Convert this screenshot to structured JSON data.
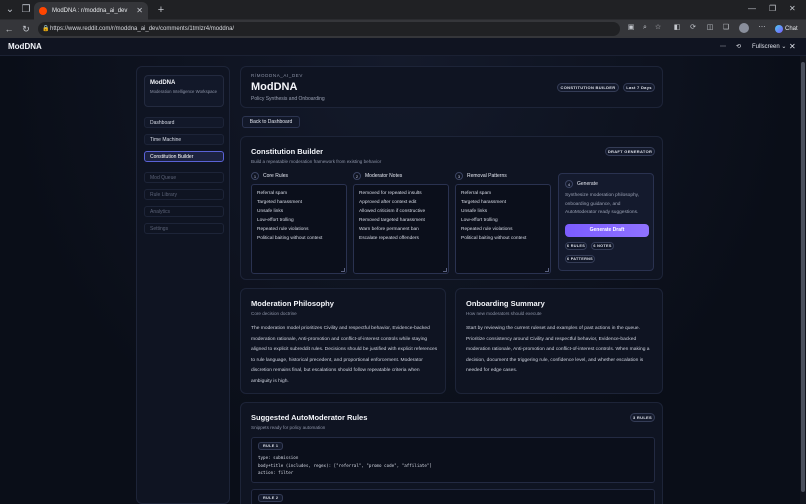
{
  "browser": {
    "tab_title": "ModDNA : r/moddna_ai_dev",
    "url": "https://www.reddit.com/r/moddna_ai_dev/comments/1tmlzr4/moddna/",
    "chat_label": "Chat"
  },
  "app_header": {
    "title": "ModDNA",
    "fullscreen_label": "Fullscreen"
  },
  "sidebar": {
    "brand_name": "ModDNA",
    "brand_sub": "Moderation Intelligence Workspace",
    "items": [
      {
        "label": "Dashboard"
      },
      {
        "label": "Time Machine"
      },
      {
        "label": "Constitution Builder"
      },
      {
        "label": "Mod Queue"
      },
      {
        "label": "Rule Library"
      },
      {
        "label": "Analytics"
      },
      {
        "label": "Settings"
      }
    ]
  },
  "header": {
    "kicker": "R/MODDNA_AI_DEV",
    "title": "ModDNA",
    "subtitle": "Policy Synthesis and Onboarding",
    "badge": "CONSTITUTION BUILDER",
    "range": "Last 7 Days"
  },
  "back_label": "Back to Dashboard",
  "builder": {
    "title": "Constitution Builder",
    "subtitle": "Build a repeatable moderation framework from existing behavior",
    "badge": "DRAFT GENERATOR",
    "columns": [
      {
        "num": "1",
        "title": "Core Rules",
        "lines": [
          "Referral spam",
          "Targeted harassment",
          "Unsafe links",
          "Low-effort trolling",
          "Repeated rule violations",
          "Political baiting without context"
        ]
      },
      {
        "num": "2",
        "title": "Moderator Notes",
        "lines": [
          "Removed for repeated insults",
          "Approved after context edit",
          "Allowed criticism if constructive",
          "Removed targeted harassment",
          "Warn before permanent ban",
          "Escalate repeated offenders"
        ]
      },
      {
        "num": "3",
        "title": "Removal Patterns",
        "lines": [
          "Referral spam",
          "Targeted harassment",
          "Unsafe links",
          "Low-effort trolling",
          "Repeated rule violations",
          "Political baiting without context"
        ]
      }
    ],
    "generate": {
      "num": "4",
      "title": "Generate",
      "desc": "Synthesize moderation philosophy, onboarding guidance, and AutoModerator ready suggestions.",
      "button": "Generate Draft",
      "chips": [
        "6 RULES",
        "6 NOTES",
        "6 PATTERNS"
      ]
    }
  },
  "philosophy": {
    "title": "Moderation Philosophy",
    "subtitle": "Core decision doctrine",
    "text": "The moderation model prioritizes Civility and respectful behavior, Evidence-backed moderation rationale, Anti-promotion and conflict-of-interest controls while staying aligned to explicit subreddit rules. Decisions should be justified with explicit references to rule language, historical precedent, and proportional enforcement. Moderator discretion remains final, but escalations should follow repeatable criteria when ambiguity is high."
  },
  "onboarding": {
    "title": "Onboarding Summary",
    "subtitle": "How new moderators should execute",
    "text": "Start by reviewing the current ruleset and examples of past actions in the queue. Prioritize consistency around Civility and respectful behavior, Evidence-backed moderation rationale, Anti-promotion and conflict-of-interest controls. When making a decision, document the triggering rule, confidence level, and whether escalation is needed for edge cases."
  },
  "automod": {
    "title": "Suggested AutoModerator Rules",
    "subtitle": "Snippets ready for policy automation",
    "badge": "3 RULES",
    "rules": [
      {
        "label": "RULE 1",
        "code": "type: submission\nbody+title (includes, regex): [\"referral\", \"promo code\", \"affiliate\"]\naction: filter"
      },
      {
        "label": "RULE 2",
        "code": ""
      }
    ]
  }
}
